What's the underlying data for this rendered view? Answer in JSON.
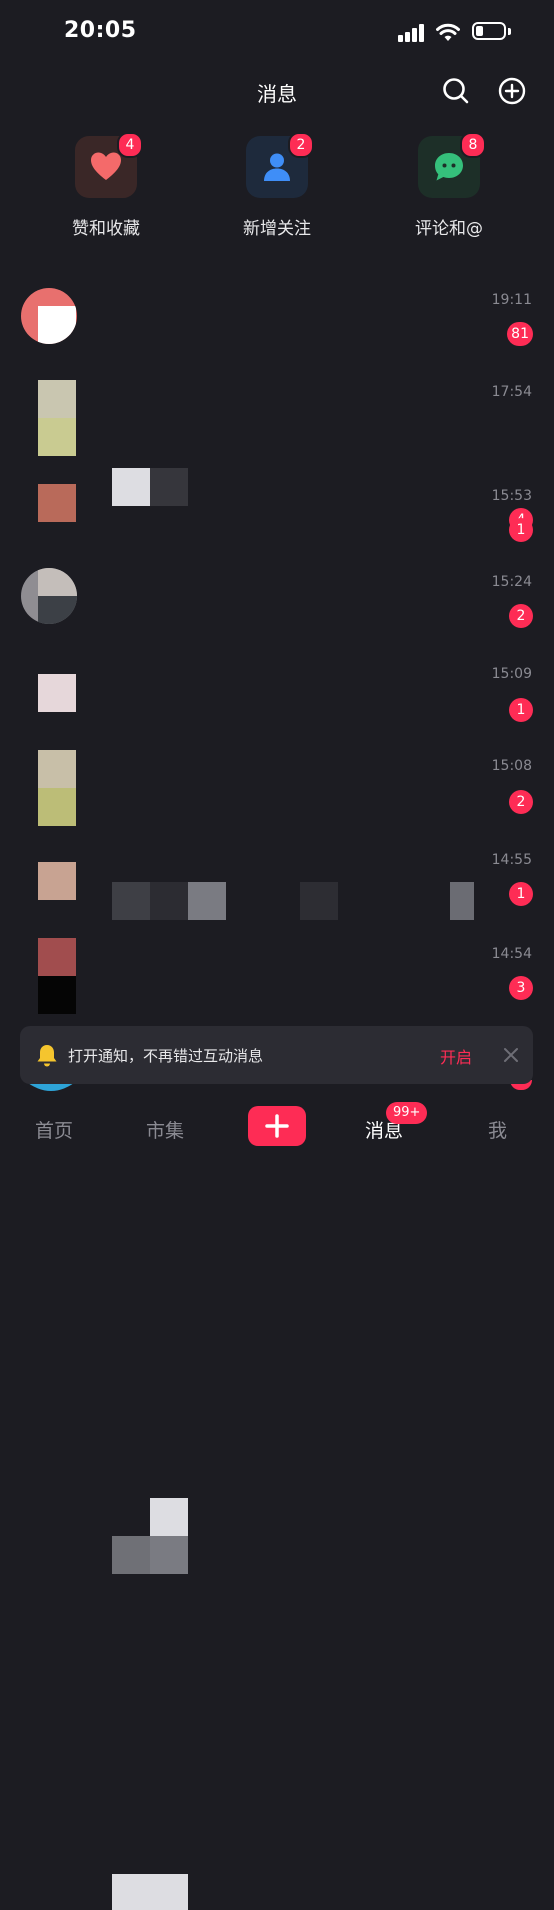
{
  "status_bar": {
    "time": "20:05"
  },
  "header": {
    "title": "消息"
  },
  "shortcuts": [
    {
      "label": "赞和收藏",
      "badge": "4",
      "icon": "heart-icon",
      "color": "#f46a6a"
    },
    {
      "label": "新增关注",
      "badge": "2",
      "icon": "person-icon",
      "color": "#3f8ef7"
    },
    {
      "label": "评论和@",
      "badge": "8",
      "icon": "chat-bubble-icon",
      "color": "#35c07b"
    }
  ],
  "messages": [
    {
      "time": "19:11",
      "badge": "81"
    },
    {
      "time": "17:54",
      "badge": "4"
    },
    {
      "time": "15:53",
      "badge": "1"
    },
    {
      "time": "15:24",
      "badge": "2"
    },
    {
      "time": "15:09",
      "badge": "1"
    },
    {
      "time": "15:08",
      "badge": "2"
    },
    {
      "time": "14:55",
      "badge": "1"
    },
    {
      "time": "14:54",
      "badge": "3"
    }
  ],
  "notification_banner": {
    "text": "打开通知，不再错过互动消息",
    "action": "开启",
    "icon": "bell-icon"
  },
  "tabbar": {
    "home": "首页",
    "market": "市集",
    "messages": "消息",
    "messages_badge": "99+",
    "me": "我"
  },
  "colors": {
    "accent": "#fe2c55",
    "background": "#1c1c22"
  }
}
